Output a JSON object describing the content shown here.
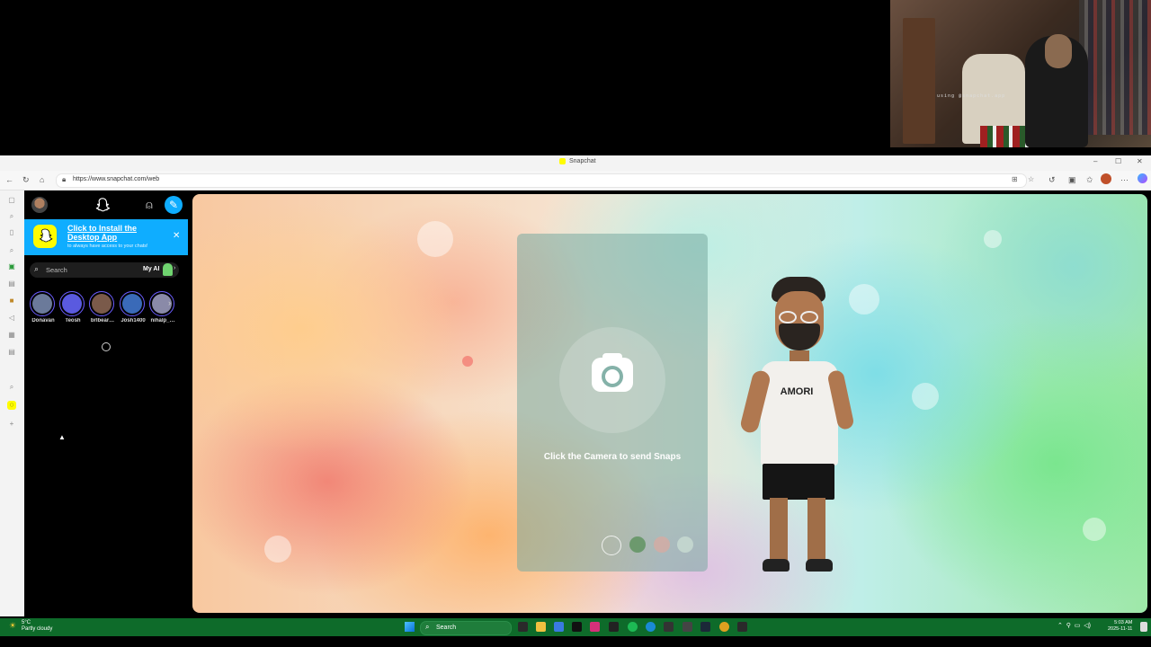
{
  "overlay_text": "using @snapchat.app",
  "browser": {
    "tab_title": "Snapchat",
    "url": "https://www.snapchat.com/web"
  },
  "sidebar": {
    "banner": {
      "title": "Click to Install the Desktop App",
      "subtitle": "to always have access to your chats!"
    },
    "search": {
      "placeholder": "Search",
      "my_ai_label": "My AI"
    },
    "stories": [
      {
        "name": "Donavan",
        "color": "#6b7a9a"
      },
      {
        "name": "Teosh",
        "color": "#5a5adf"
      },
      {
        "name": "brlbear…",
        "color": "#7a5a4a"
      },
      {
        "name": "Josh1400",
        "color": "#3a6ab8"
      },
      {
        "name": "nihalp_…",
        "color": "#8a8aa8"
      }
    ]
  },
  "main": {
    "camera_hint": "Click the Camera to send Snaps"
  },
  "bitmoji": {
    "shirt_text": "AMORI"
  },
  "taskbar": {
    "temp": "5°C",
    "weather": "Partly cloudy",
    "search_label": "Search",
    "time": "5:03 AM",
    "date": "2025-11-11"
  },
  "colors": {
    "snap_yellow": "#fffc00",
    "snap_blue": "#0fadff",
    "taskbar_green": "#0e6b2a"
  }
}
